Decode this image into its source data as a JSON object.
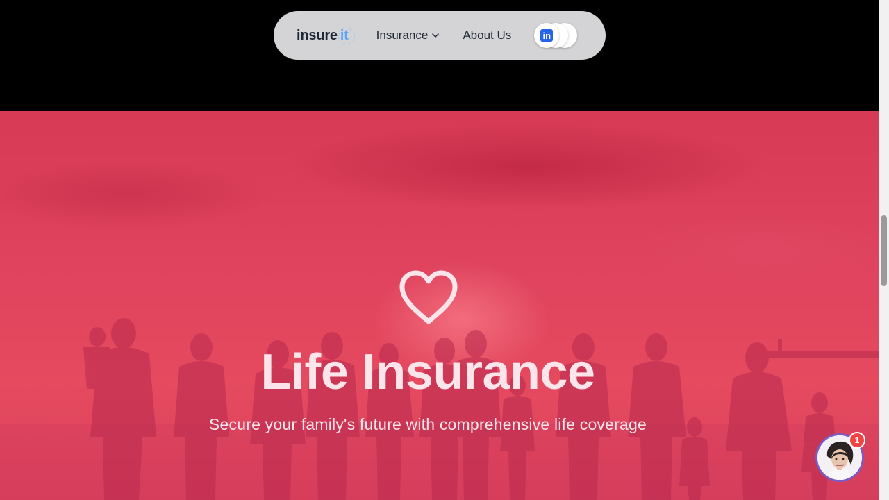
{
  "navbar": {
    "logo_main": "insure",
    "logo_accent": "it",
    "insurance_label": "Insurance",
    "about_label": "About Us",
    "socials": [
      "linkedin-icon",
      "instagram-icon",
      "meta-icon"
    ]
  },
  "hero": {
    "icon": "heart-icon",
    "title": "Life Insurance",
    "subtitle": "Secure your family's future with comprehensive life coverage"
  },
  "chat": {
    "unread_count": "1"
  },
  "colors": {
    "hero_overlay": "#e0445e",
    "navbar_bg": "#d4d4d6",
    "accent": "#60a5fa",
    "badge": "#ef4444"
  }
}
